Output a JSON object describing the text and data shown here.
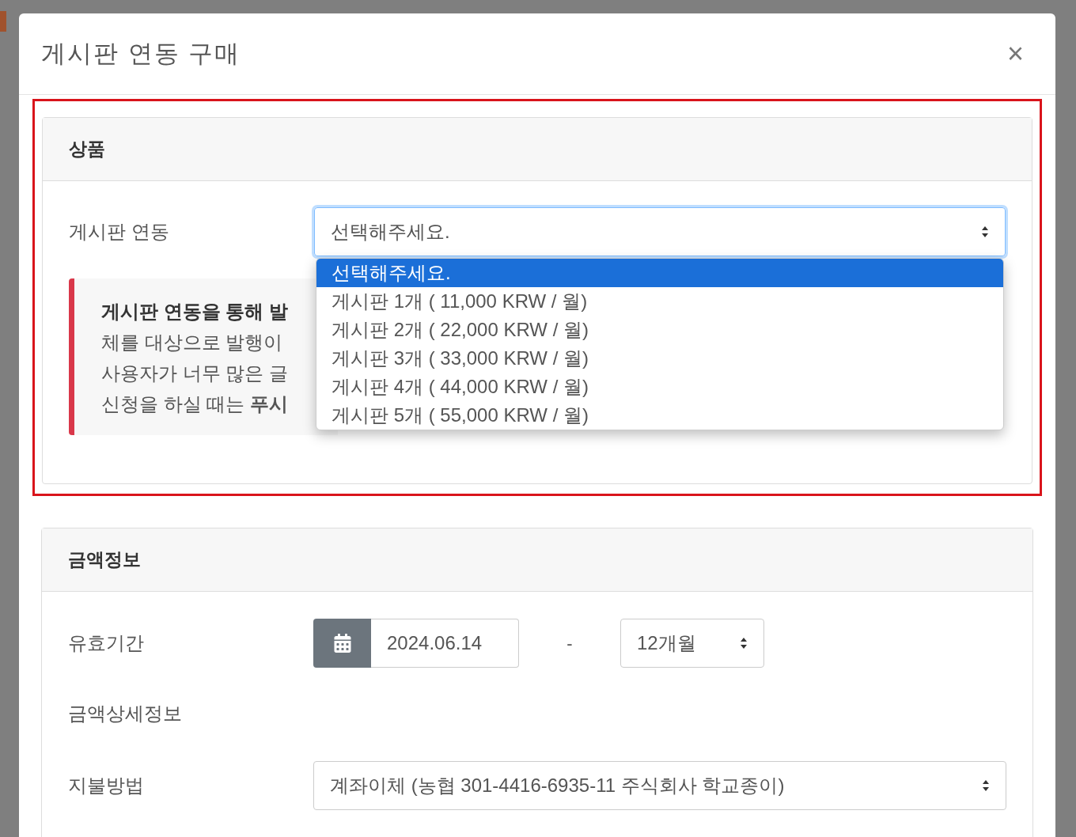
{
  "modal": {
    "title": "게시판 연동 구매",
    "close": "×"
  },
  "product_section": {
    "heading": "상품",
    "highlighted": true,
    "field": {
      "label": "게시판 연동",
      "value": "선택해주세요.",
      "expanded": true,
      "options": [
        {
          "label": "선택해주세요.",
          "selected": true
        },
        {
          "label": "게시판 1개 ( 11,000 KRW / 월)",
          "selected": false
        },
        {
          "label": "게시판 2개 ( 22,000 KRW / 월)",
          "selected": false
        },
        {
          "label": "게시판 3개 ( 33,000 KRW / 월)",
          "selected": false
        },
        {
          "label": "게시판 4개 ( 44,000 KRW / 월)",
          "selected": false
        },
        {
          "label": "게시판 5개 ( 55,000 KRW / 월)",
          "selected": false
        }
      ]
    },
    "notice": {
      "lines": [
        {
          "text": "게시판 연동을 통해 발",
          "bold": true
        },
        {
          "text": "체를 대상으로 발행이",
          "bold": false
        },
        {
          "text": "사용자가 너무 많은 글",
          "bold": false
        },
        {
          "text": "신청을 하실 때는 **푸시**",
          "bold": false
        }
      ]
    }
  },
  "price_section": {
    "heading": "금액정보",
    "period": {
      "label": "유효기간",
      "start_date": "2024.06.14",
      "separator": "-",
      "duration": "12개월"
    },
    "detail_label": "금액상세정보",
    "payment": {
      "label": "지불방법",
      "value": "계좌이체 (농협 301-4416-6935-11 주식회사 학교종이)"
    }
  }
}
